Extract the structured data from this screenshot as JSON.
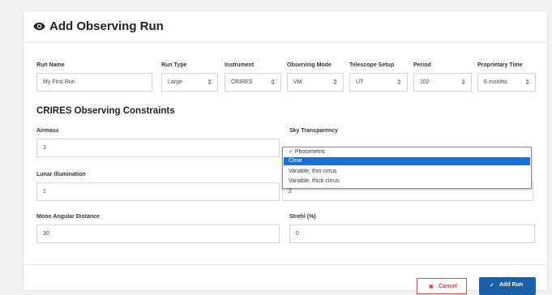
{
  "dialog": {
    "title": "Add Observing Run",
    "section_title": "CRIRES Observing Constraints"
  },
  "run_fields": {
    "run_name": {
      "label": "Run Name",
      "value": "My First Run"
    },
    "run_type": {
      "label": "Run Type",
      "value": "Large"
    },
    "instrument": {
      "label": "Instrument",
      "value": "CRIRES"
    },
    "observing_mode": {
      "label": "Observing Mode",
      "value": "VM"
    },
    "telescope_setup": {
      "label": "Telescope Setup",
      "value": "UT"
    },
    "period": {
      "label": "Period",
      "value": "102"
    },
    "proprietary_time": {
      "label": "Proprietary Time",
      "value": "6 months"
    }
  },
  "constraints": {
    "airmass": {
      "label": "Airmass",
      "value": "3"
    },
    "sky_transparency": {
      "label": "Sky Transparency",
      "value": "Clear"
    },
    "lunar_illumination": {
      "label": "Lunar Illumination",
      "value": "1"
    },
    "seeing": {
      "value": "2"
    },
    "moon_angular_distance": {
      "label": "Moon Angular Distance",
      "value": "30"
    },
    "strehl": {
      "label": "Strehl (%)",
      "value": "0"
    }
  },
  "sky_transparency_options": {
    "opt0": "Photometric",
    "opt1": "Clear",
    "opt2": "Variable, thin cirrus",
    "opt3": "Variable, thick cirrus",
    "selected_index": 1
  },
  "buttons": {
    "cancel": "Cancel",
    "add_run": "Add Run"
  },
  "colors": {
    "accent": "#1b5fa8",
    "selection": "#1c6fd1",
    "danger": "#e04848"
  },
  "icons": {
    "header": "eye-icon",
    "cancel": "close-icon",
    "add": "check-icon",
    "select_arrow": "up-down-arrow-icon"
  }
}
